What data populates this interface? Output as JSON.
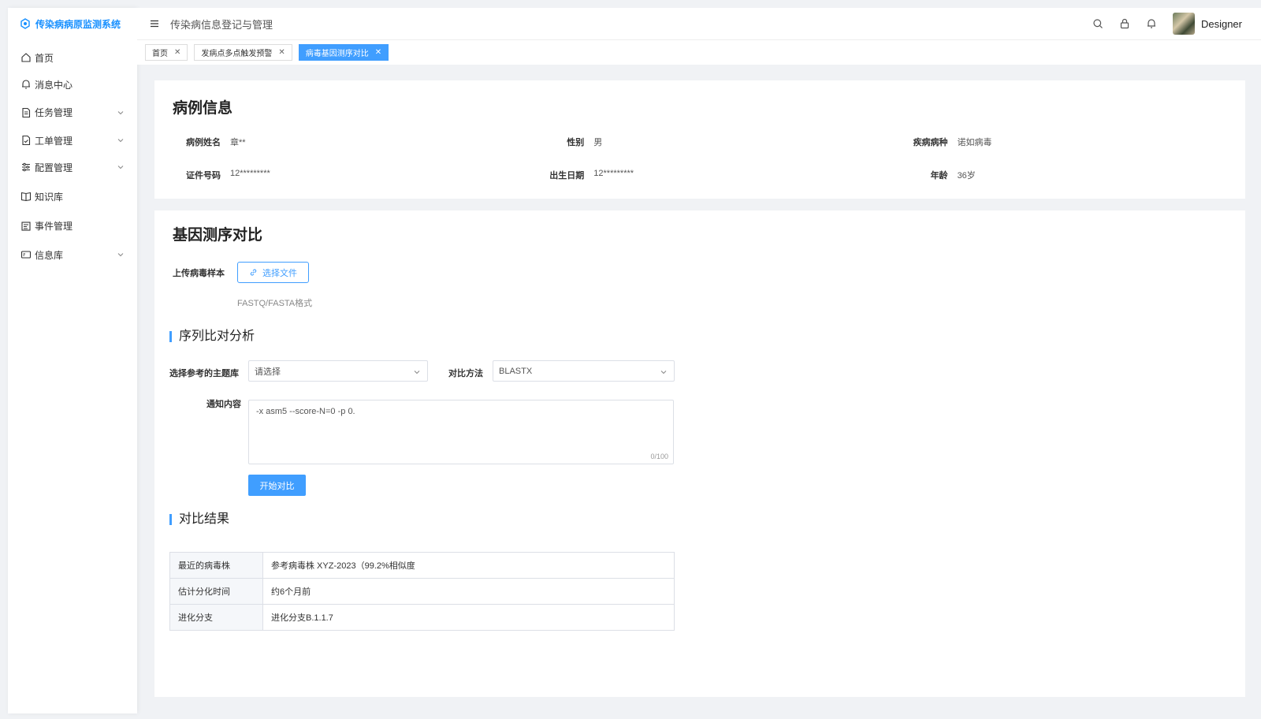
{
  "app": {
    "title": "传染病病原监测系统",
    "brand_color": "#1890ff",
    "accent_color": "#409eff"
  },
  "sidebar": {
    "items": [
      {
        "label": "首页",
        "icon": "home-icon",
        "expandable": false
      },
      {
        "label": "消息中心",
        "icon": "bell-icon",
        "expandable": false
      },
      {
        "label": "任务管理",
        "icon": "document-icon",
        "expandable": true
      },
      {
        "label": "工单管理",
        "icon": "ticket-icon",
        "expandable": true
      },
      {
        "label": "配置管理",
        "icon": "sliders-icon",
        "expandable": true
      },
      {
        "label": "知识库",
        "icon": "book-icon",
        "expandable": false
      },
      {
        "label": "事件管理",
        "icon": "event-icon",
        "expandable": false
      },
      {
        "label": "信息库",
        "icon": "database-icon",
        "expandable": true
      }
    ]
  },
  "header": {
    "title": "传染病信息登记与管理",
    "username": "Designer",
    "icons": [
      "search-icon",
      "lock-icon",
      "bell-icon"
    ]
  },
  "tabs": [
    {
      "label": "首页",
      "active": false
    },
    {
      "label": "发病点多点触发预警",
      "active": false
    },
    {
      "label": "病毒基因测序对比",
      "active": true
    }
  ],
  "case_info": {
    "title": "病例信息",
    "fields": [
      {
        "label": "病例姓名",
        "value": "章**"
      },
      {
        "label": "性别",
        "value": "男"
      },
      {
        "label": "疾病病种",
        "value": "诺如病毒"
      },
      {
        "label": "证件号码",
        "value": "12*********"
      },
      {
        "label": "出生日期",
        "value": "12*********"
      },
      {
        "label": "年龄",
        "value": "36岁"
      }
    ]
  },
  "gene": {
    "title": "基因测序对比",
    "upload_label": "上传病毒样本",
    "upload_button": "选择文件",
    "upload_hint": "FASTQ/FASTA格式",
    "alignment_section": "序列比对分析",
    "ref_db_label": "选择参考的主题库",
    "ref_db_placeholder": "请选择",
    "method_label": "对比方法",
    "method_value": "BLASTX",
    "notice_label": "通知内容",
    "notice_value": "-x asm5 --score-N=0 -p 0.",
    "notice_counter": "0/100",
    "start_button": "开始对比",
    "result_section": "对比结果",
    "results": [
      {
        "key": "最近的病毒株",
        "value": "参考病毒株 XYZ-2023（99.2%相似度"
      },
      {
        "key": "估计分化时间",
        "value": "约6个月前"
      },
      {
        "key": "进化分支",
        "value": "进化分支B.1.1.7"
      }
    ]
  }
}
